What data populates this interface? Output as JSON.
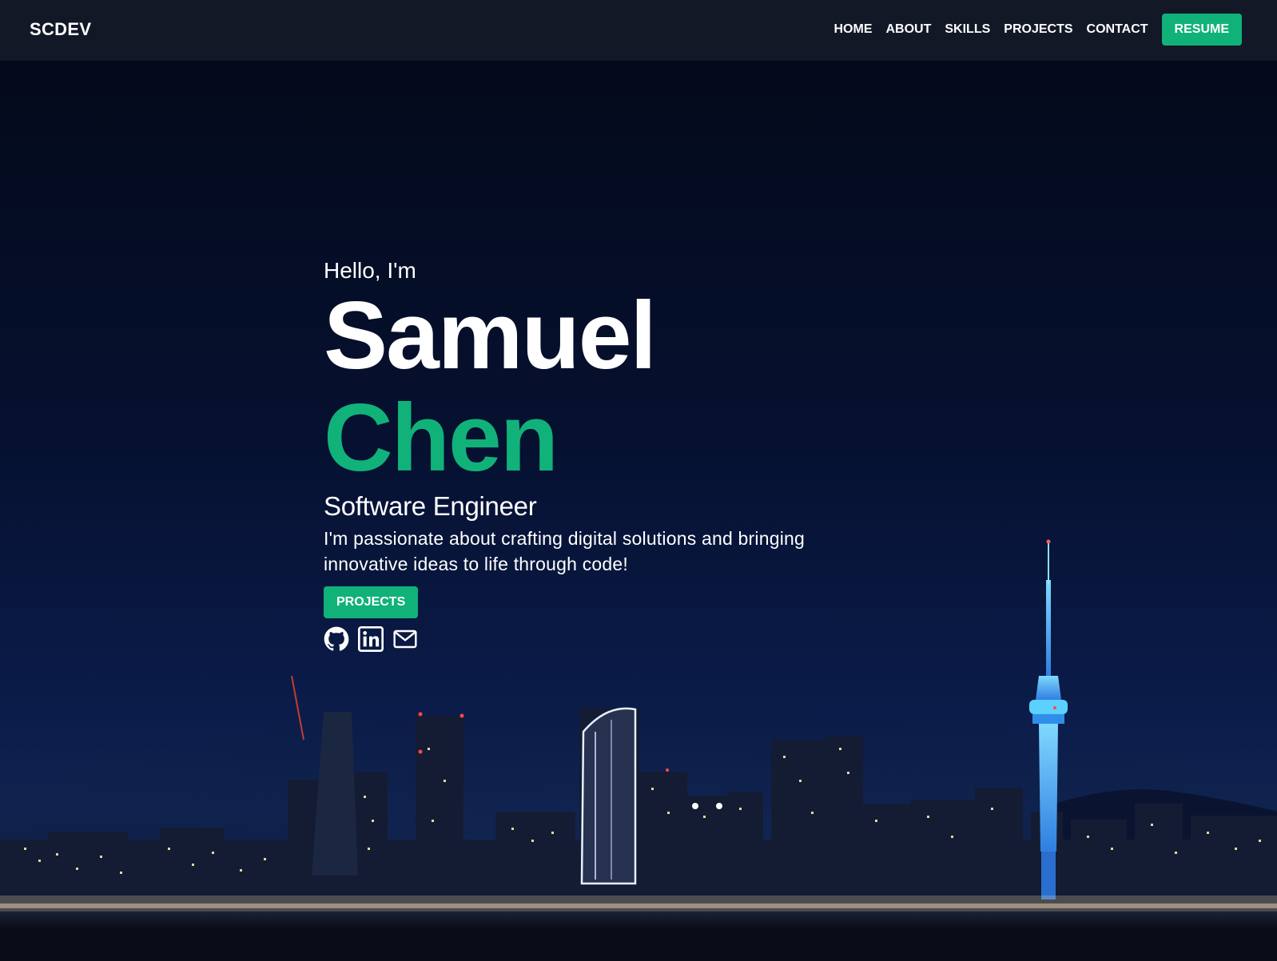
{
  "nav": {
    "brand": "SCDEV",
    "links": [
      "HOME",
      "ABOUT",
      "SKILLS",
      "PROJECTS",
      "CONTACT"
    ],
    "resume_label": "RESUME"
  },
  "hero": {
    "greeting": "Hello, I'm",
    "first_name": "Samuel",
    "last_name": "Chen",
    "role": "Software Engineer",
    "tagline": "I'm passionate about crafting digital solutions and bringing innovative ideas to life through code!",
    "projects_label": "PROJECTS",
    "socials": [
      "github-icon",
      "linkedin-icon",
      "mail-icon"
    ]
  },
  "colors": {
    "accent": "#10b27a",
    "nav_bg": "#121826",
    "hero_bg": "#061131"
  }
}
